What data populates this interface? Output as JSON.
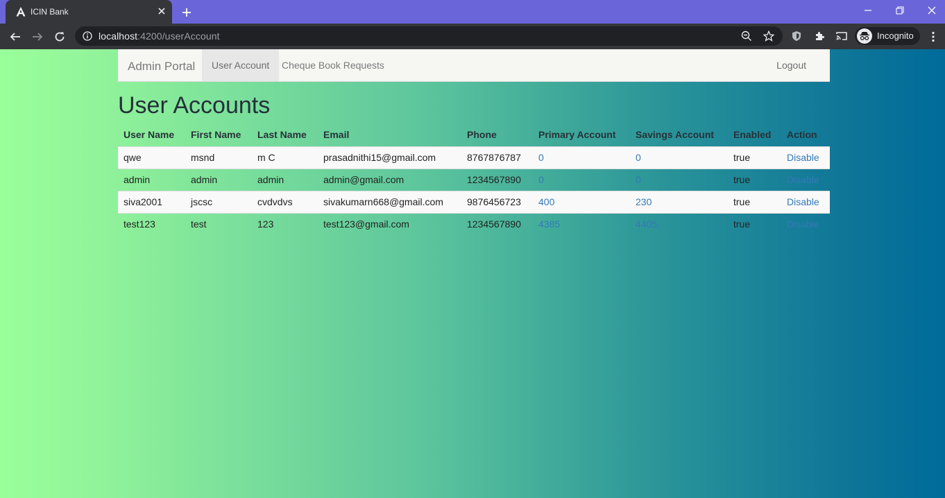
{
  "browser": {
    "tab_title": "ICIN Bank",
    "url_host": "localhost",
    "url_rest": ":4200/userAccount",
    "profile_label": "Incognito",
    "colors": {
      "tabstrip": "#6a66d9",
      "toolbar": "#35363a",
      "omnibox": "#202124"
    }
  },
  "navbar": {
    "brand": "Admin Portal",
    "items": [
      {
        "label": "User Account",
        "active": true
      },
      {
        "label": "Cheque Book Requests",
        "active": false
      }
    ],
    "logout": "Logout"
  },
  "page": {
    "heading": "User Accounts"
  },
  "table": {
    "headers": [
      "User Name",
      "First Name",
      "Last Name",
      "Email",
      "Phone",
      "Primary Account",
      "Savings Account",
      "Enabled",
      "Action"
    ],
    "rows": [
      {
        "username": "qwe",
        "first": "msnd",
        "last": "m C",
        "email": "prasadnithi15@gmail.com",
        "phone": "8767876787",
        "primary": "0",
        "savings": "0",
        "enabled": "true",
        "action": "Disable"
      },
      {
        "username": "admin",
        "first": "admin",
        "last": "admin",
        "email": "admin@gmail.com",
        "phone": "1234567890",
        "primary": "0",
        "savings": "0",
        "enabled": "true",
        "action": "Disable"
      },
      {
        "username": "siva2001",
        "first": "jscsc",
        "last": "cvdvdvs",
        "email": "sivakumarn668@gmail.com",
        "phone": "9876456723",
        "primary": "400",
        "savings": "230",
        "enabled": "true",
        "action": "Disable"
      },
      {
        "username": "test123",
        "first": "test",
        "last": "123",
        "email": "test123@gmail.com",
        "phone": "1234567890",
        "primary": "4385",
        "savings": "4405",
        "enabled": "true",
        "action": "Disable"
      }
    ]
  },
  "theme": {
    "gradient_start": "#99ff99",
    "gradient_end": "#006b9a",
    "link_color": "#337ab7"
  }
}
